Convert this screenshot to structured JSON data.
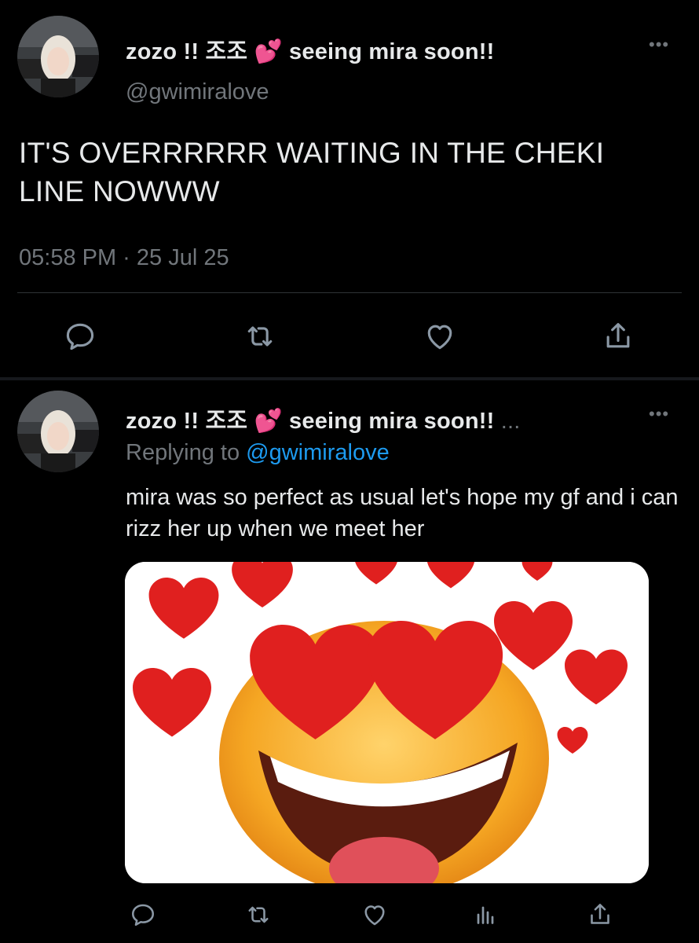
{
  "tweet": {
    "display_name": "zozo !! 조조 💕 seeing mira soon!!",
    "handle": "@gwimiralove",
    "text": "IT'S OVERRRRRR WAITING IN THE CHEKI LINE NOWWW",
    "timestamp": "05:58 PM · 25 Jul 25",
    "more_label": "•••"
  },
  "reply": {
    "display_name": "zozo !! 조조 💕 seeing mira soon!!",
    "truncation": "...",
    "replying_prefix": "Replying to",
    "replying_mention": "@gwimiralove",
    "text": "mira was so perfect as usual let's hope my gf and i can rizz her up when we meet her",
    "more_label": "•••"
  },
  "icons": {
    "reply": "reply-icon",
    "retweet": "retweet-icon",
    "like": "heart-icon",
    "share": "share-icon",
    "views": "analytics-icon"
  },
  "colors": {
    "background": "#000000",
    "text": "#e7e9ea",
    "muted": "#71767b",
    "link": "#1d9bf0",
    "heart_red": "#e0201f",
    "emoji_yellow": "#f5b533"
  }
}
